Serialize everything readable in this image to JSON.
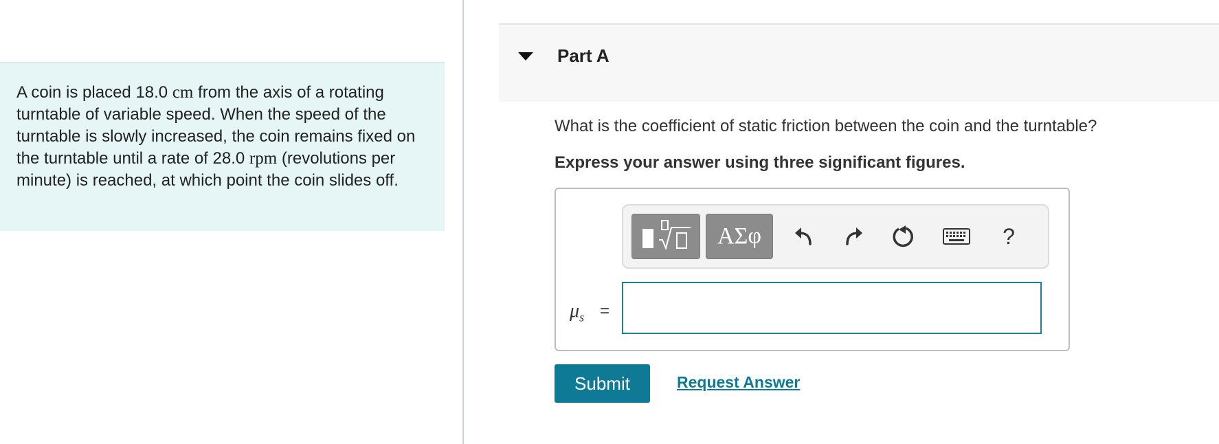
{
  "problem": {
    "segments": [
      {
        "text": "A coin is placed 18.0 ",
        "mono": false
      },
      {
        "text": "cm",
        "mono": true
      },
      {
        "text": " from the axis of a rotating turntable of variable speed. When the speed of the turntable is slowly increased, the coin remains fixed on the turntable until a rate of 28.0 ",
        "mono": false
      },
      {
        "text": "rpm",
        "mono": true
      },
      {
        "text": " (revolutions per minute) is reached, at which point the coin slides off.",
        "mono": false
      }
    ]
  },
  "part": {
    "title": "Part A",
    "collapse_icon": "caret-down-icon"
  },
  "question": "What is the coefficient of static friction between the coin and the turntable?",
  "instruction": "Express your answer using three significant figures.",
  "toolbar": {
    "templates_icon": "templates-radical-icon",
    "symbols_label": "ΑΣφ",
    "undo_icon": "undo-icon",
    "redo_icon": "redo-icon",
    "reset_icon": "reset-icon",
    "keyboard_icon": "keyboard-icon",
    "help_label": "?"
  },
  "answer": {
    "variable": "μ",
    "subscript": "s",
    "equals": "=",
    "value": ""
  },
  "actions": {
    "submit_label": "Submit",
    "request_label": "Request Answer"
  },
  "colors": {
    "accent": "#0f7a96",
    "problem_bg": "#e6f5f5"
  }
}
